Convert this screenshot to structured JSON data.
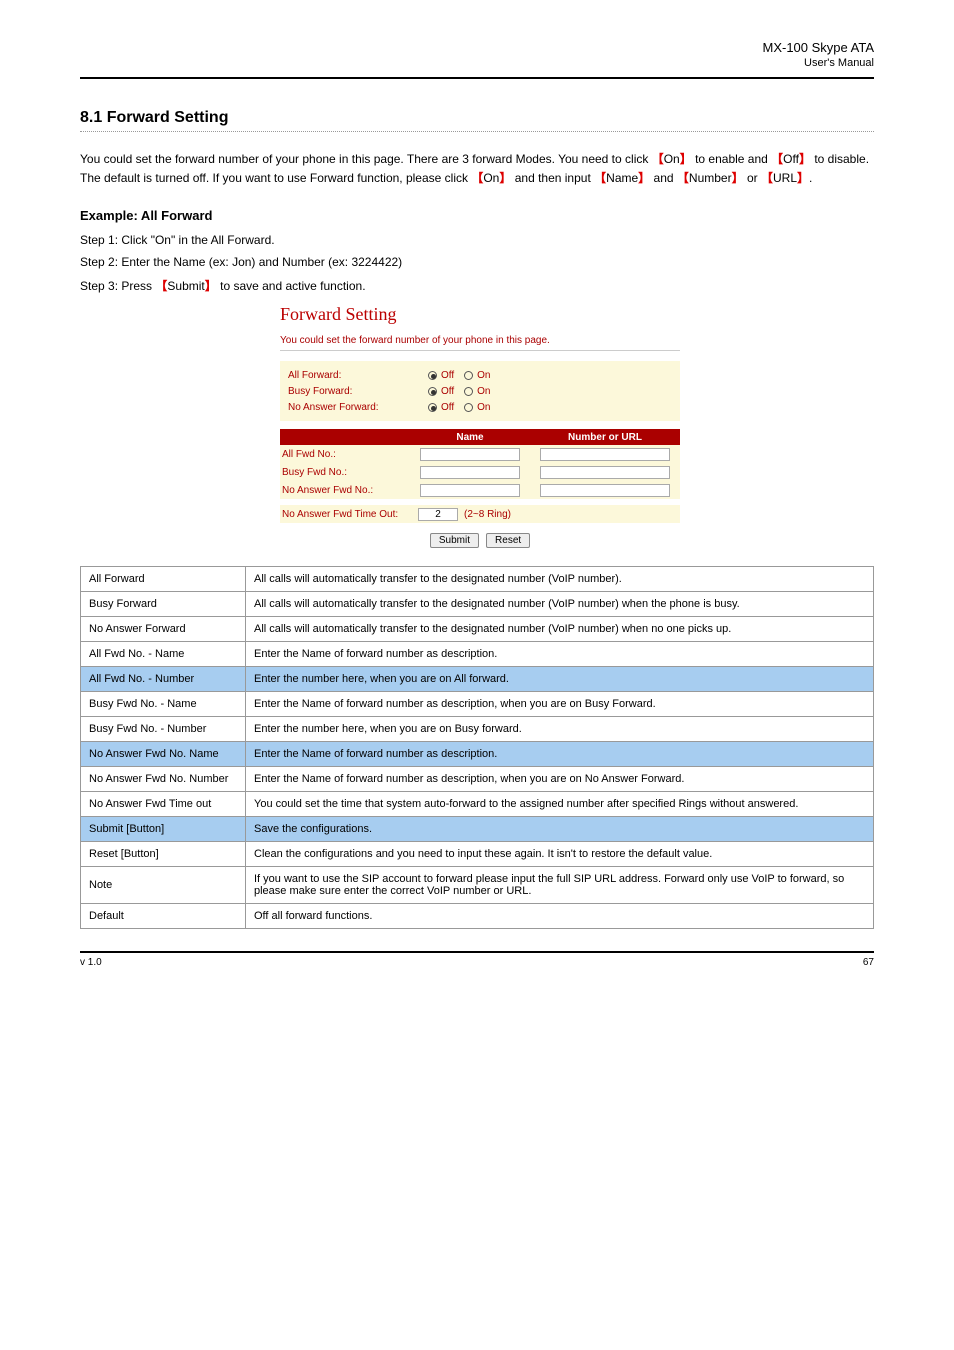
{
  "header": {
    "title": "MX-100 Skype ATA",
    "subtitle": "User's Manual"
  },
  "section": {
    "title": "8.1 Forward Setting",
    "paragraph1_a": "You could set the forward number of your phone in this page. There are 3 forward Modes. You need to click ",
    "paragraph1_on": "On",
    "paragraph1_b": " to enable and ",
    "paragraph1_off": "Off",
    "paragraph1_c": " to disable. The default is turned off. If you want to use Forward function, please click ",
    "paragraph1_on2": "On",
    "paragraph1_d": " and then input",
    "paragraph2_a": "Name",
    "paragraph2_b": "and",
    "paragraph2_c": "Number",
    "paragraph2_d": "or",
    "paragraph2_e": "URL",
    "paragraph2_f": ".",
    "example_title": "Example: All Forward",
    "step1": "Step 1: Click \"On\" in the All Forward.",
    "step2": "Step 2: Enter the Name (ex: Jon) and Number (ex: 3224422)",
    "step3_a": "Step 3: Press ",
    "step3_btn": "Submit",
    "step3_b": " to save and active function."
  },
  "screenshot": {
    "title": "Forward Setting",
    "caption": "You could set the forward number of your phone in this page.",
    "rows": [
      {
        "label": "All Forward:",
        "off": "Off",
        "on": "On"
      },
      {
        "label": "Busy Forward:",
        "off": "Off",
        "on": "On"
      },
      {
        "label": "No Answer Forward:",
        "off": "Off",
        "on": "On"
      }
    ],
    "tbl_name": "Name",
    "tbl_num": "Number or URL",
    "tbl_rows": [
      "All Fwd No.:",
      "Busy Fwd No.:",
      "No Answer Fwd No.:"
    ],
    "timeout_label": "No Answer Fwd Time Out:",
    "timeout_value": "2",
    "timeout_hint": "(2~8 Ring)",
    "submit": "Submit",
    "reset": "Reset"
  },
  "table": [
    {
      "label": "All Forward",
      "desc": "All calls will automatically transfer to the designated number (VoIP number).",
      "shaded": false
    },
    {
      "label": "Busy Forward",
      "desc": "All calls will automatically transfer to the designated number (VoIP number) when the phone is busy.",
      "shaded": false
    },
    {
      "label": "No Answer Forward",
      "desc": "All calls will automatically transfer to the designated number (VoIP number) when no one picks up.",
      "shaded": false
    },
    {
      "label": "All Fwd No. - Name",
      "desc": "Enter the Name of forward number as description.",
      "shaded": false
    },
    {
      "label": "All Fwd No. - Number",
      "desc": "Enter the number here, when you are on All forward.",
      "shaded": true
    },
    {
      "label": "Busy Fwd No. - Name",
      "desc": "Enter the Name of forward number as description, when you are on Busy Forward.",
      "shaded": false
    },
    {
      "label": "Busy Fwd No. - Number",
      "desc": "Enter the number here, when you are on Busy forward.",
      "shaded": false
    },
    {
      "label": "No Answer Fwd No. Name",
      "desc": "Enter the Name of forward number as description.",
      "shaded": true
    },
    {
      "label": "No Answer Fwd No. Number",
      "desc": "Enter the Name of forward number as description, when you are on No Answer Forward.",
      "shaded": false
    },
    {
      "label": "No Answer Fwd Time out",
      "desc": "You could set the time that system auto-forward to the assigned number after specified Rings without answered.",
      "shaded": false
    },
    {
      "label": "Submit [Button]",
      "desc": "Save the configurations.",
      "shaded": true
    },
    {
      "label": "Reset [Button]",
      "desc": "Clean the configurations and you need to input these again. It isn't to restore the default value.",
      "shaded": false
    },
    {
      "label": "Note",
      "desc": "If you want to use the SIP account to forward please input the full SIP URL address. Forward only use VoIP to forward, so please make sure enter the correct VoIP number or URL.",
      "shaded": false
    },
    {
      "label": "Default",
      "desc": "Off all forward functions.",
      "shaded": false
    }
  ],
  "footer": {
    "left": "v 1.0",
    "right": "67"
  }
}
